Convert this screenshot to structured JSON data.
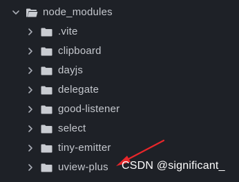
{
  "explorer": {
    "parent": {
      "label": "node_modules",
      "expanded": true,
      "icon": "folder-open-icon"
    },
    "children": [
      {
        "label": ".vite",
        "icon": "folder-icon",
        "expanded": false
      },
      {
        "label": "clipboard",
        "icon": "folder-icon",
        "expanded": false
      },
      {
        "label": "dayjs",
        "icon": "folder-icon",
        "expanded": false
      },
      {
        "label": "delegate",
        "icon": "folder-icon",
        "expanded": false
      },
      {
        "label": "good-listener",
        "icon": "folder-icon",
        "expanded": false
      },
      {
        "label": "select",
        "icon": "folder-icon",
        "expanded": false
      },
      {
        "label": "tiny-emitter",
        "icon": "folder-icon",
        "expanded": false
      },
      {
        "label": "uview-plus",
        "icon": "folder-icon",
        "expanded": false
      }
    ]
  },
  "watermark": {
    "text": "CSDN @significant_"
  },
  "colors": {
    "background": "#1e2127",
    "text": "#c5c8ce",
    "folder": "#c9ccd2",
    "chevron": "#a9adb5",
    "arrow": "#e8262a",
    "watermark": "#ffffff"
  }
}
